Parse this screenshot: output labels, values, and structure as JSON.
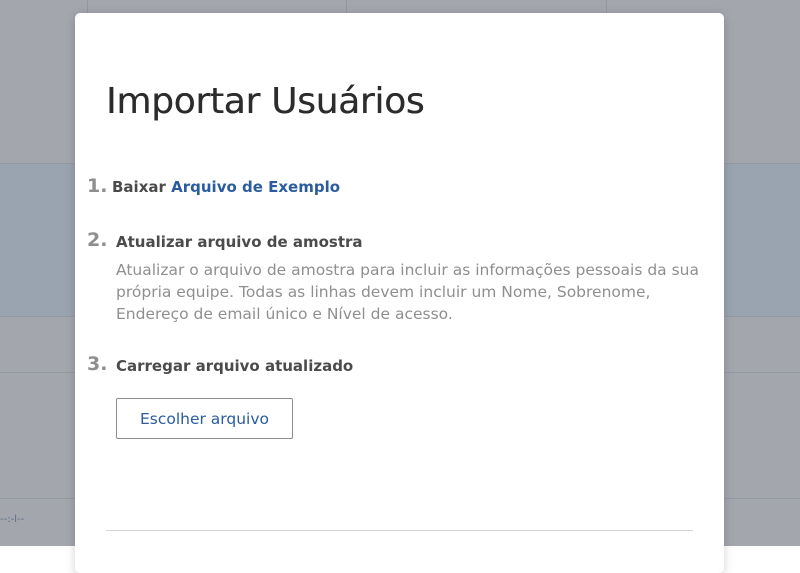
{
  "modal": {
    "title": "Importar Usuários",
    "steps": [
      {
        "number": "1.",
        "label_prefix": "Baixar ",
        "link_label": "Arquivo de Exemplo"
      },
      {
        "number": "2.",
        "label": "Atualizar arquivo de amostra",
        "description": "Atualizar o arquivo de amostra para incluir as informações pessoais da sua própria equipe. Todas as linhas devem incluir um Nome, Sobrenome, Endereço de email único e Nível de acesso."
      },
      {
        "number": "3.",
        "label": "Carregar arquivo atualizado",
        "button_label": "Escolher arquivo"
      }
    ]
  },
  "background": {
    "glyph_text": "--:-l--"
  },
  "colors": {
    "link": "#2a5c9e",
    "step_number": "#8e8e8e",
    "overlay": "#a3a6ad"
  }
}
